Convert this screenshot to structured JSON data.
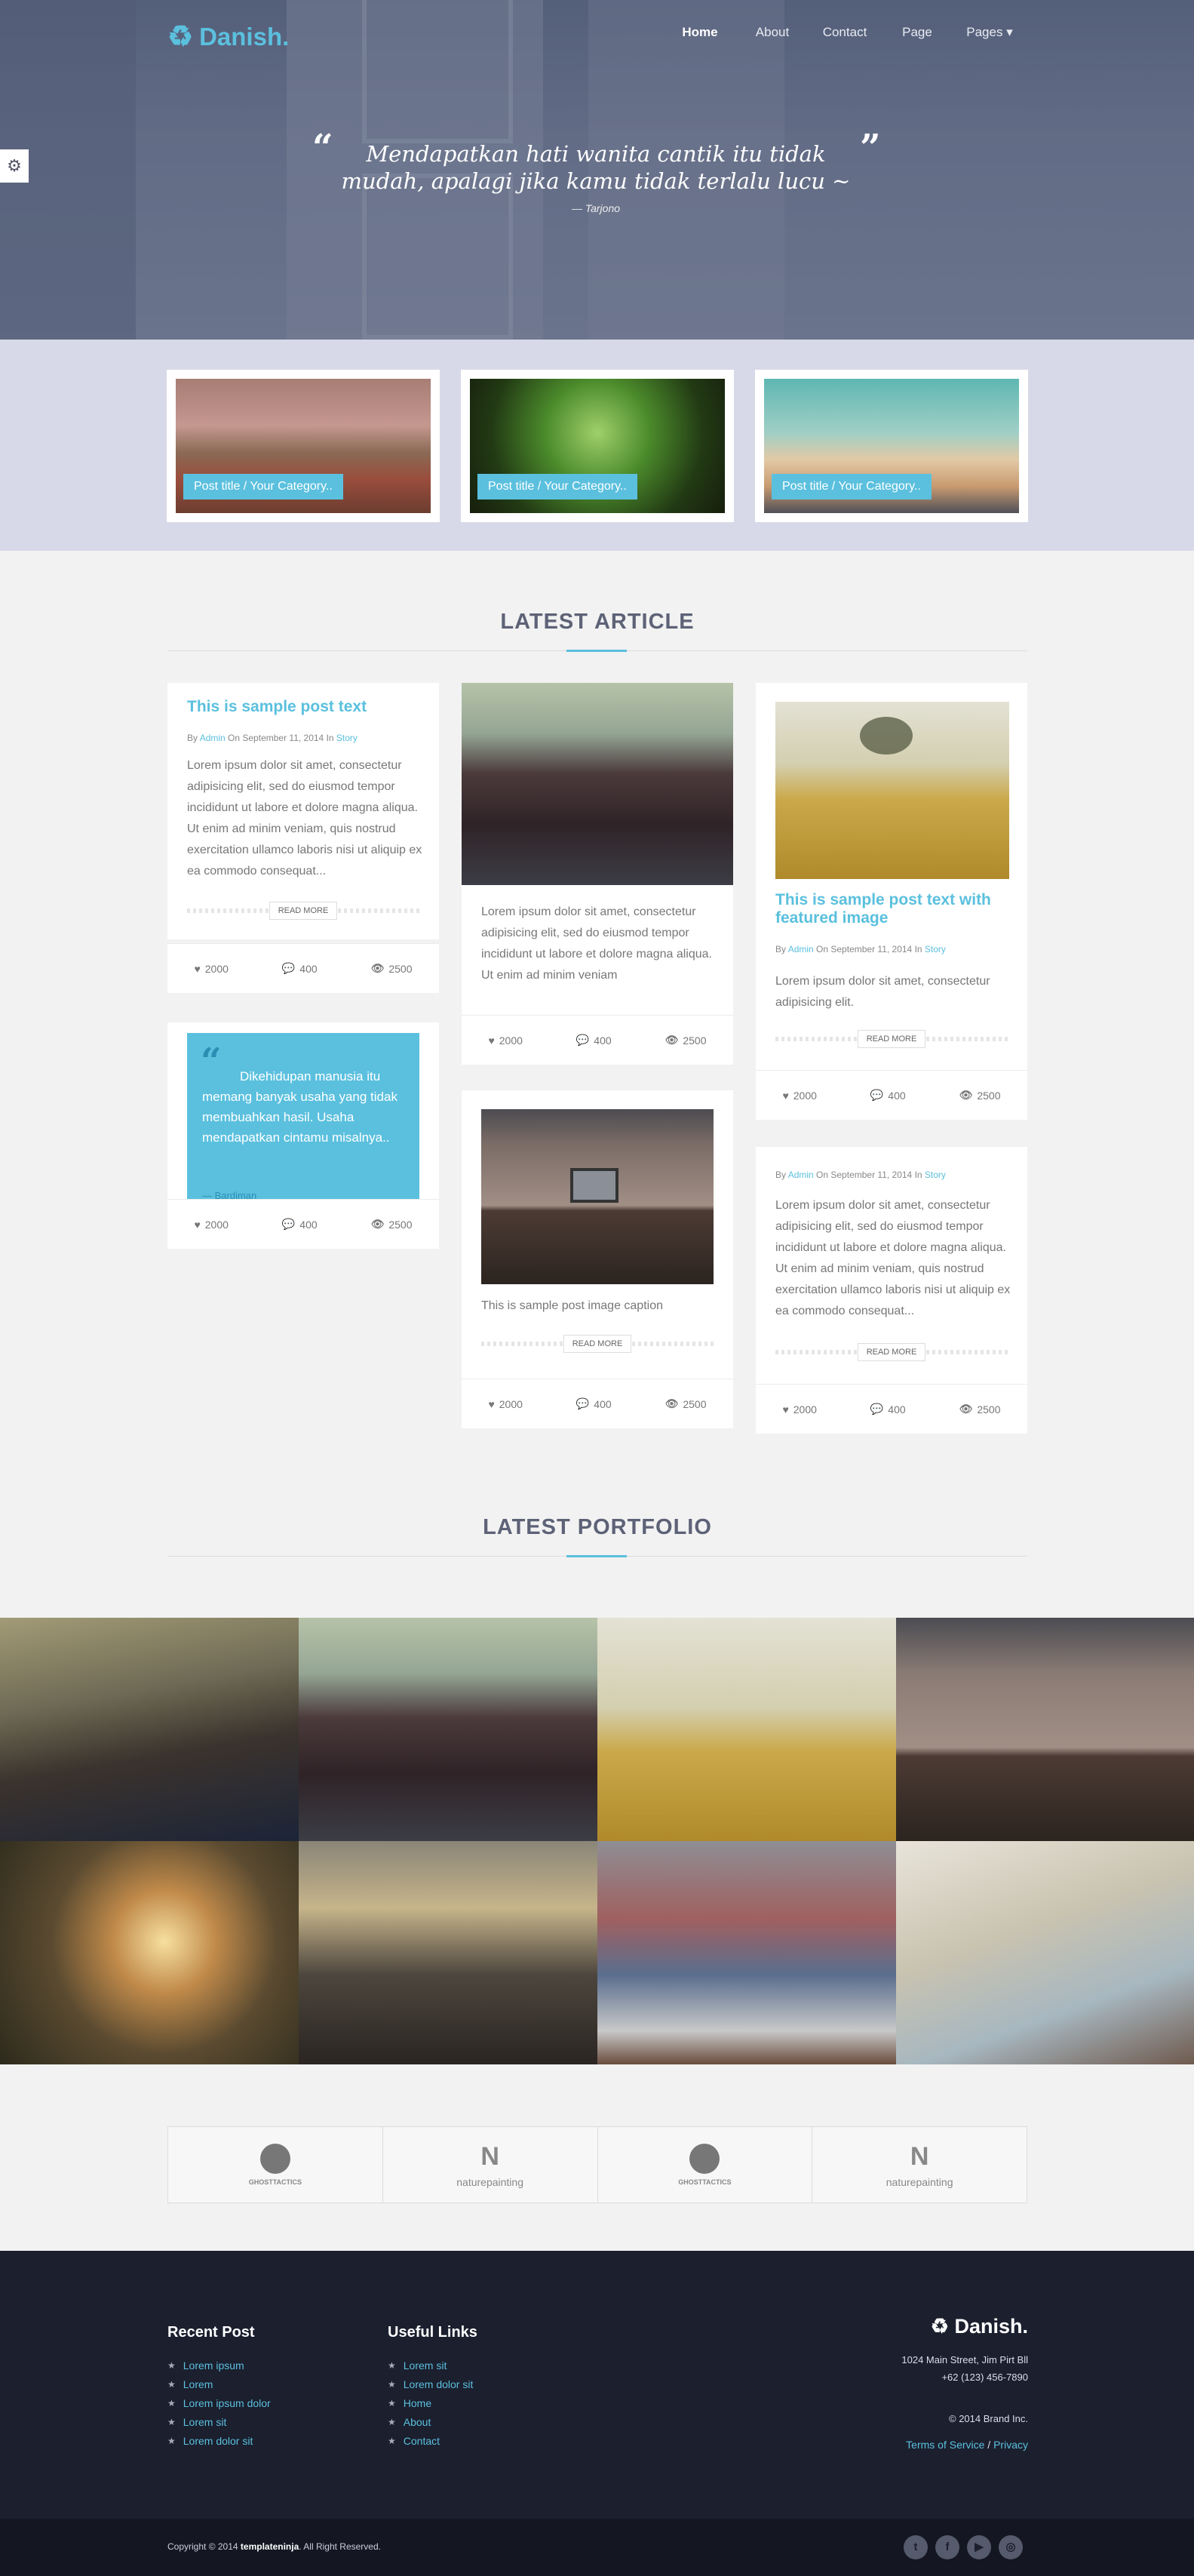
{
  "brand": {
    "name": "Danish.",
    "icon": "recycle-icon",
    "accent": "#5bc0de"
  },
  "nav": {
    "items": [
      "Home",
      "About",
      "Contact",
      "Page",
      "Pages ▾"
    ]
  },
  "hero": {
    "quote": "Mendapatkan hati wanita cantik itu tidak mudah, apalagi jika kamu tidak terlalu lucu ~",
    "author": "— Tarjono"
  },
  "featured": [
    {
      "label": "Post title / Your Category.."
    },
    {
      "label": "Post title / Your Category.."
    },
    {
      "label": "Post title / Your Category.."
    }
  ],
  "latest_article": {
    "title": "LATEST ARTICLE",
    "card1": {
      "title": "This is sample post text",
      "meta_by": "By ",
      "meta_author": "Admin",
      "meta_on": " On September 11, 2014 In ",
      "meta_cat": "Story",
      "body": "Lorem ipsum dolor sit amet, consectetur adipisicing elit, sed do eiusmod tempor incididunt ut labore et dolore magna aliqua. Ut enim ad minim veniam, quis nostrud exercitation ullamco laboris nisi ut aliquip ex ea commodo consequat...",
      "read_more": "READ MORE",
      "likes": "2000",
      "comments": "400",
      "views": "2500"
    },
    "card2": {
      "quote": "Dikehidupan manusia itu memang banyak usaha yang tidak membuahkan hasil. Usaha mendapatkan cintamu misalnya..",
      "author": "— Bardiman",
      "likes": "2000",
      "comments": "400",
      "views": "2500"
    },
    "card3": {
      "body": "Lorem ipsum dolor sit amet, consectetur adipisicing elit, sed do eiusmod tempor incididunt ut labore et dolore magna aliqua. Ut enim ad minim veniam",
      "likes": "2000",
      "comments": "400",
      "views": "2500"
    },
    "card4": {
      "caption": "This is sample post image caption",
      "read_more": "READ MORE",
      "likes": "2000",
      "comments": "400",
      "views": "2500"
    },
    "card5": {
      "title": "This is sample post text with featured image",
      "meta_by": "By ",
      "meta_author": "Admin",
      "meta_on": " On September 11, 2014 In ",
      "meta_cat": "Story",
      "body": "Lorem ipsum dolor sit amet, consectetur adipisicing elit.",
      "read_more": "READ MORE",
      "likes": "2000",
      "comments": "400",
      "views": "2500"
    },
    "card6": {
      "meta_by": "By ",
      "meta_author": "Admin",
      "meta_on": " On September 11, 2014 In ",
      "meta_cat": "Story",
      "body": "Lorem ipsum dolor sit amet, consectetur adipisicing elit, sed do eiusmod tempor incididunt ut labore et dolore magna aliqua. Ut enim ad minim veniam, quis nostrud exercitation ullamco laboris nisi ut aliquip ex ea commodo consequat...",
      "read_more": "READ MORE",
      "likes": "2000",
      "comments": "400",
      "views": "2500"
    }
  },
  "latest_portfolio": {
    "title": "LATEST PORTFOLIO"
  },
  "clients": [
    {
      "name": "GHOSTTACTICS",
      "icon": "ghost-logo-icon"
    },
    {
      "name": "naturepainting",
      "icon": "naturepainting-logo-icon"
    },
    {
      "name": "GHOSTTACTICS",
      "icon": "ghost-logo-icon"
    },
    {
      "name": "naturepainting",
      "icon": "naturepainting-logo-icon"
    }
  ],
  "footer": {
    "recent_title": "Recent Post",
    "recent": [
      "Lorem ipsum",
      "Lorem",
      "Lorem ipsum dolor",
      "Lorem sit",
      "Lorem dolor sit"
    ],
    "useful_title": "Useful Links",
    "useful": [
      "Lorem sit",
      "Lorem dolor sit",
      "Home",
      "About",
      "Contact"
    ],
    "brand": "Danish.",
    "address": "1024 Main Street, Jim Pirt Bll",
    "phone": "+62 (123) 456-7890",
    "copyright_brand": "© 2014 Brand Inc.",
    "terms": "Terms of Service",
    "sep": " / ",
    "privacy": "Privacy",
    "bottom_copy_pre": "Copyright © 2014 ",
    "bottom_copy_brand": "templateninja",
    "bottom_copy_post": ". All Right Reserved.",
    "social": [
      "twitter-icon",
      "facebook-icon",
      "youtube-icon",
      "instagram-icon"
    ]
  }
}
